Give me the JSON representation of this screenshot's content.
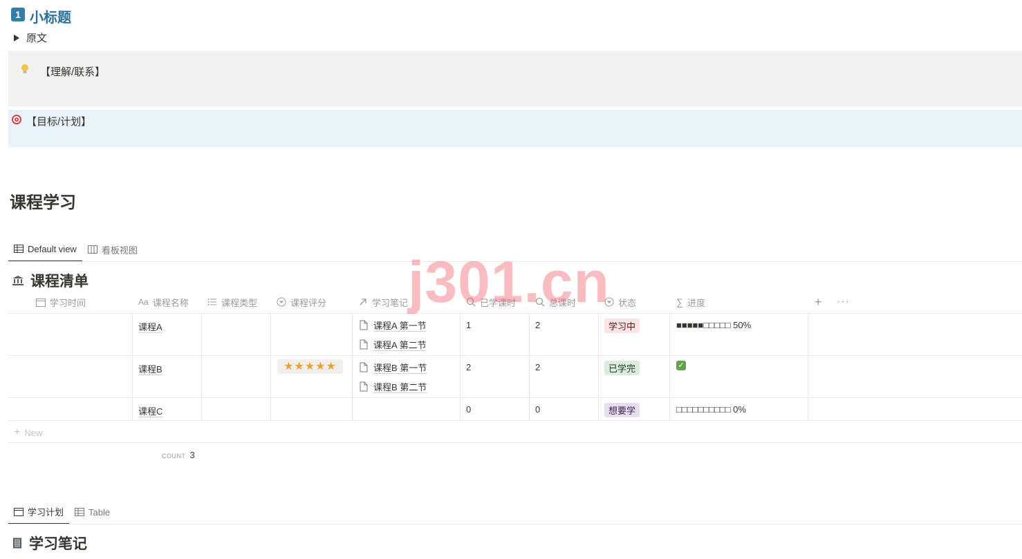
{
  "section": {
    "number": "1",
    "title": "小标题"
  },
  "toggle": {
    "label": "原文"
  },
  "callouts": {
    "understanding": "【理解/联系】",
    "goal": "【目标/计划】"
  },
  "heading": "课程学习",
  "db1": {
    "tabs": [
      {
        "label": "Default view",
        "icon": "table-icon",
        "active": true
      },
      {
        "label": "看板视图",
        "icon": "board-icon",
        "active": false
      }
    ],
    "title": "课程清单",
    "columns": {
      "time": "学习时间",
      "name": "课程名称",
      "type": "课程类型",
      "rating": "课程评分",
      "notes": "学习笔记",
      "done_hours": "已学课时",
      "total_hours": "总课时",
      "status": "状态",
      "progress": "进度"
    },
    "rows": [
      {
        "name": "课程A",
        "rating": "",
        "notes": [
          "课程A 第一节",
          "课程A 第二节"
        ],
        "done_hours": "1",
        "total_hours": "2",
        "status": "学习中",
        "progress": "■■■■■□□□□□ 50%"
      },
      {
        "name": "课程B",
        "rating": "★★★★★",
        "notes": [
          "课程B 第一节",
          "课程B 第二节"
        ],
        "done_hours": "2",
        "total_hours": "2",
        "status": "已学完",
        "progress": "✓"
      },
      {
        "name": "课程C",
        "rating": "",
        "notes": [],
        "done_hours": "0",
        "total_hours": "0",
        "status": "想要学",
        "progress": "□□□□□□□□□□ 0%"
      }
    ],
    "new_label": "New",
    "count_label": "COUNT",
    "count_value": "3",
    "status_colors": {
      "学习中": "#fbe4e4",
      "已学完": "#dbeddb",
      "想要学": "#e8deee"
    }
  },
  "db2": {
    "tabs": [
      {
        "label": "学习计划",
        "icon": "calendar-icon",
        "active": true
      },
      {
        "label": "Table",
        "icon": "table-icon",
        "active": false
      }
    ],
    "title": "学习笔记"
  },
  "watermark": "j301.cn"
}
